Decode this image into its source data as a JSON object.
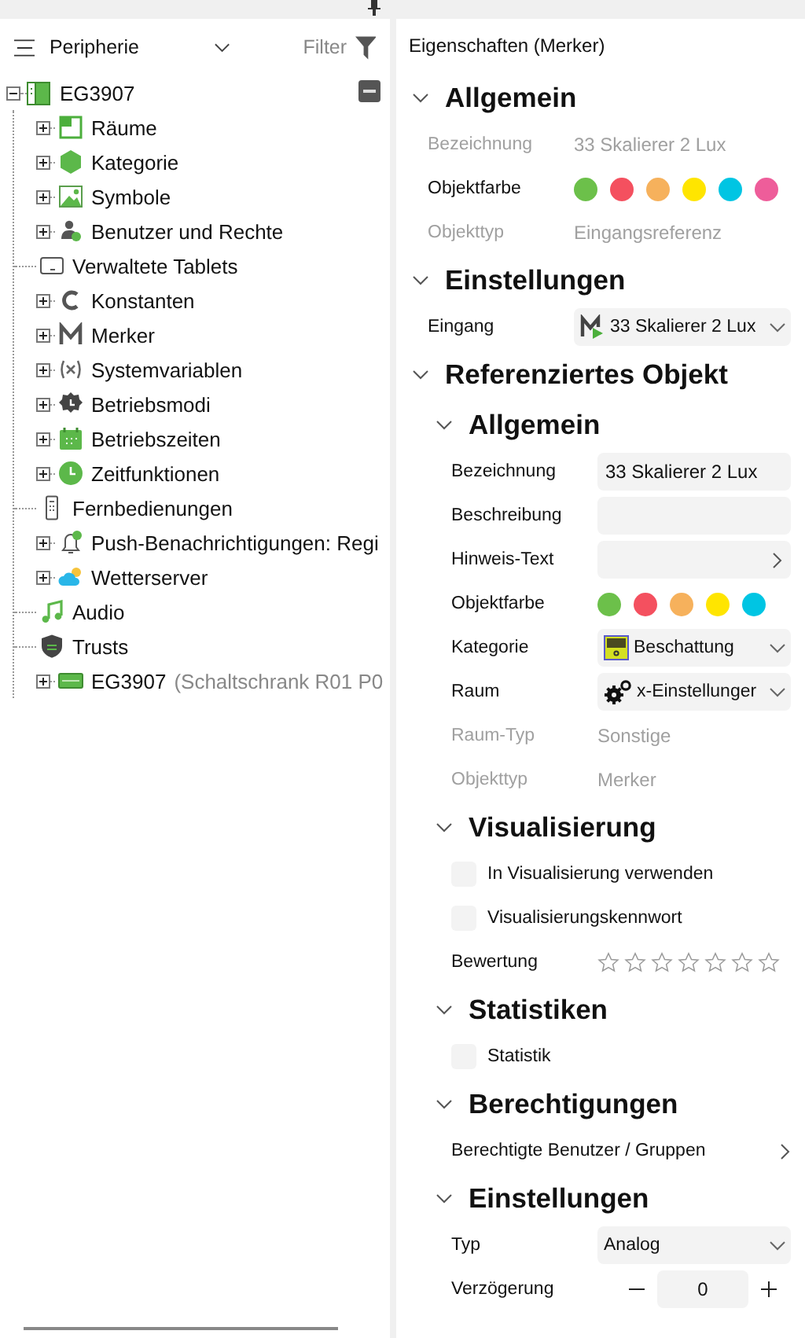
{
  "tree_panel": {
    "view": "Peripherie",
    "filter_label": "Filter"
  },
  "tree": {
    "label": "EG3907",
    "expanded": true,
    "children": [
      {
        "label": "Räume",
        "has_children": true
      },
      {
        "label": "Kategorie",
        "has_children": true
      },
      {
        "label": "Symbole",
        "has_children": true
      },
      {
        "label": "Benutzer und Rechte",
        "has_children": true
      },
      {
        "label": "Verwaltete Tablets",
        "has_children": false
      },
      {
        "label": "Konstanten",
        "has_children": true
      },
      {
        "label": "Merker",
        "has_children": true
      },
      {
        "label": "Systemvariablen",
        "has_children": true
      },
      {
        "label": "Betriebsmodi",
        "has_children": true
      },
      {
        "label": "Betriebszeiten",
        "has_children": true
      },
      {
        "label": "Zeitfunktionen",
        "has_children": true
      },
      {
        "label": "Fernbedienungen",
        "has_children": false
      },
      {
        "label": "Push-Benachrichtigungen: Regi",
        "has_children": true
      },
      {
        "label": "Wetterserver",
        "has_children": true
      },
      {
        "label": "Audio",
        "has_children": false
      },
      {
        "label": "Trusts",
        "has_children": false
      },
      {
        "label": "EG3907",
        "detail": "(Schaltschrank R01 P0",
        "has_children": true
      }
    ]
  },
  "properties": {
    "title": "Eigenschaften (Merker)",
    "sections": [
      {
        "title": "Allgemein",
        "expanded": true,
        "rows": [
          {
            "kind": "readonly",
            "label": "Bezeichnung",
            "value": "33 Skalierer 2 Lux"
          },
          {
            "kind": "colors",
            "label": "Objektfarbe",
            "colors": [
              {
                "color": "#6cc04a"
              },
              {
                "color": "#f4505f"
              },
              {
                "color": "#f6b15c"
              },
              {
                "color": "#ffe500"
              },
              {
                "color": "#00c5e3"
              },
              {
                "color": "#ee5d9a"
              }
            ]
          },
          {
            "kind": "readonly",
            "label": "Objekttyp",
            "value": "Eingangsreferenz"
          }
        ]
      },
      {
        "title": "Einstellungen",
        "expanded": true,
        "rows": [
          {
            "kind": "dropdown",
            "label": "Eingang",
            "value": "33 Skalierer 2 Lux"
          }
        ]
      },
      {
        "title": "Referenziertes Objekt",
        "expanded": true,
        "sections": [
          {
            "title": "Allgemein",
            "expanded": true,
            "rows": [
              {
                "kind": "input",
                "label": "Bezeichnung",
                "value": "33 Skalierer 2 Lux"
              },
              {
                "kind": "input",
                "label": "Beschreibung"
              },
              {
                "kind": "link-field",
                "label": "Hinweis-Text"
              },
              {
                "kind": "colors",
                "label": "Objektfarbe",
                "colors": [
                  {
                    "color": "#6cc04a"
                  },
                  {
                    "color": "#f4505f"
                  },
                  {
                    "color": "#f6b15c"
                  },
                  {
                    "color": "#ffe500"
                  },
                  {
                    "color": "#00c5e3"
                  }
                ]
              },
              {
                "kind": "dropdown",
                "label": "Kategorie",
                "value": "Beschattung"
              },
              {
                "kind": "dropdown",
                "label": "Raum",
                "value": "x-Einstellunger"
              },
              {
                "kind": "readonly",
                "label": "Raum-Typ",
                "value": "Sonstige"
              },
              {
                "kind": "readonly",
                "label": "Objekttyp",
                "value": "Merker"
              }
            ]
          },
          {
            "title": "Visualisierung",
            "expanded": true,
            "rows": [
              {
                "kind": "checkbox",
                "label": "In Visualisierung verwenden",
                "checked": false
              },
              {
                "kind": "checkbox",
                "label": "Visualisierungskennwort",
                "checked": false
              },
              {
                "kind": "stars",
                "label": "Bewertung",
                "stars": 0
              }
            ]
          },
          {
            "title": "Statistiken",
            "expanded": true,
            "rows": [
              {
                "kind": "checkbox",
                "label": "Statistik",
                "checked": false
              }
            ]
          },
          {
            "title": "Berechtigungen",
            "expanded": true,
            "rows": [
              {
                "kind": "link",
                "label": "Berechtigte Benutzer / Gruppen"
              }
            ]
          },
          {
            "title": "Einstellungen",
            "expanded": true,
            "rows": [
              {
                "kind": "dropdown",
                "label": "Typ",
                "value": "Analog"
              },
              {
                "kind": "stepper",
                "label": "Verzögerung",
                "value": "0"
              }
            ]
          }
        ]
      }
    ]
  }
}
